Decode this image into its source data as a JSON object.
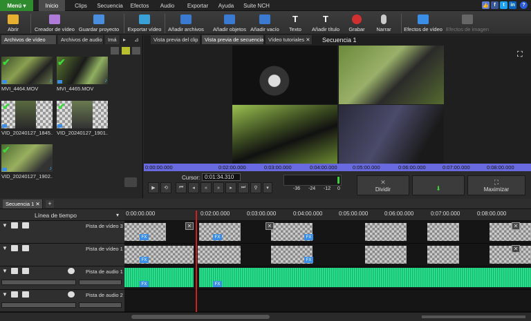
{
  "menubar": {
    "menu_label": "Menú",
    "tabs": [
      "Inicio",
      "Clips",
      "Secuencia",
      "Efectos",
      "Audio",
      "Exportar",
      "Ayuda",
      "Suite NCH"
    ],
    "active_tab": "Inicio",
    "right_icons": [
      "thumbs-up-icon",
      "facebook-icon",
      "twitter-icon",
      "linkedin-icon",
      "help-icon"
    ]
  },
  "toolbar": {
    "buttons": [
      {
        "label": "Abrir",
        "icon": "folder-icon"
      },
      {
        "label": "Creador de vídeo",
        "icon": "wizard-icon"
      },
      {
        "label": "Guardar proyecto",
        "icon": "save-icon"
      },
      {
        "label": "Exportar vídeo",
        "icon": "export-icon"
      },
      {
        "label": "Añadir archivos",
        "icon": "add-files-icon"
      },
      {
        "label": "Añadir objetos",
        "icon": "add-objects-icon"
      },
      {
        "label": "Añadir vacío",
        "icon": "add-blank-icon"
      },
      {
        "label": "Texto",
        "icon": "text-icon"
      },
      {
        "label": "Añadir título",
        "icon": "title-icon"
      },
      {
        "label": "Grabar",
        "icon": "record-icon"
      },
      {
        "label": "Narrar",
        "icon": "microphone-icon"
      },
      {
        "label": "Efectos de vídeo",
        "icon": "video-effects-icon"
      },
      {
        "label": "Efectos de imagen",
        "icon": "image-effects-icon"
      }
    ]
  },
  "left_panel": {
    "tabs": [
      "Archivos de vídeo",
      "Archivos de audio",
      "Imá"
    ],
    "clips": [
      {
        "name": "MVI_4464.MOV",
        "checked": true,
        "audio": true
      },
      {
        "name": "MVI_4465.MOV",
        "checked": true,
        "audio": true
      },
      {
        "name": "VID_20240127_1845...",
        "checked": true,
        "audio": false
      },
      {
        "name": "VID_20240127_1901...",
        "checked": true,
        "audio": false
      },
      {
        "name": "VID_20240127_1902...",
        "checked": true,
        "audio": true
      }
    ]
  },
  "preview": {
    "tabs": [
      "Vista previa del clip",
      "Vista previa de secuencia",
      "Vídeo tutoriales",
      "Secuencia 1"
    ],
    "ruler_times": [
      "0:00:00.000",
      "0:02:00.000",
      "0:03:00.000",
      "0:04:00.000",
      "0:05:00.000",
      "0:06:00.000",
      "0:07:00.000",
      "0:08:00.000"
    ],
    "cursor_label": "Cursor:",
    "cursor_value": "0:01:34.310",
    "meter_labels": [
      "-36",
      "-24",
      "-12",
      "0"
    ],
    "split_label": "Dividir",
    "maximize_label": "Maximizar"
  },
  "timeline": {
    "sequence_tab": "Secuencia 1",
    "header_label": "Línea de tiempo",
    "ruler_times": [
      "0:00:00.000",
      "0:02:00.000",
      "0:03:00.000",
      "0:04:00.000",
      "0:05:00.000",
      "0:06:00.000",
      "0:07:00.000",
      "0:08:00.000"
    ],
    "tracks": [
      {
        "name": "Pista de vídeo 3",
        "kind": "video"
      },
      {
        "name": "Pista de vídeo 1",
        "kind": "video"
      },
      {
        "name": "Pista de audio 1",
        "kind": "audio"
      },
      {
        "name": "Pista de audio 2",
        "kind": "audio"
      }
    ]
  },
  "colors": {
    "menu_green": "#2e8b2e",
    "ruler_blue": "#6a6ae0",
    "waveform": "#1fcf7f",
    "playhead": "#d02020"
  }
}
